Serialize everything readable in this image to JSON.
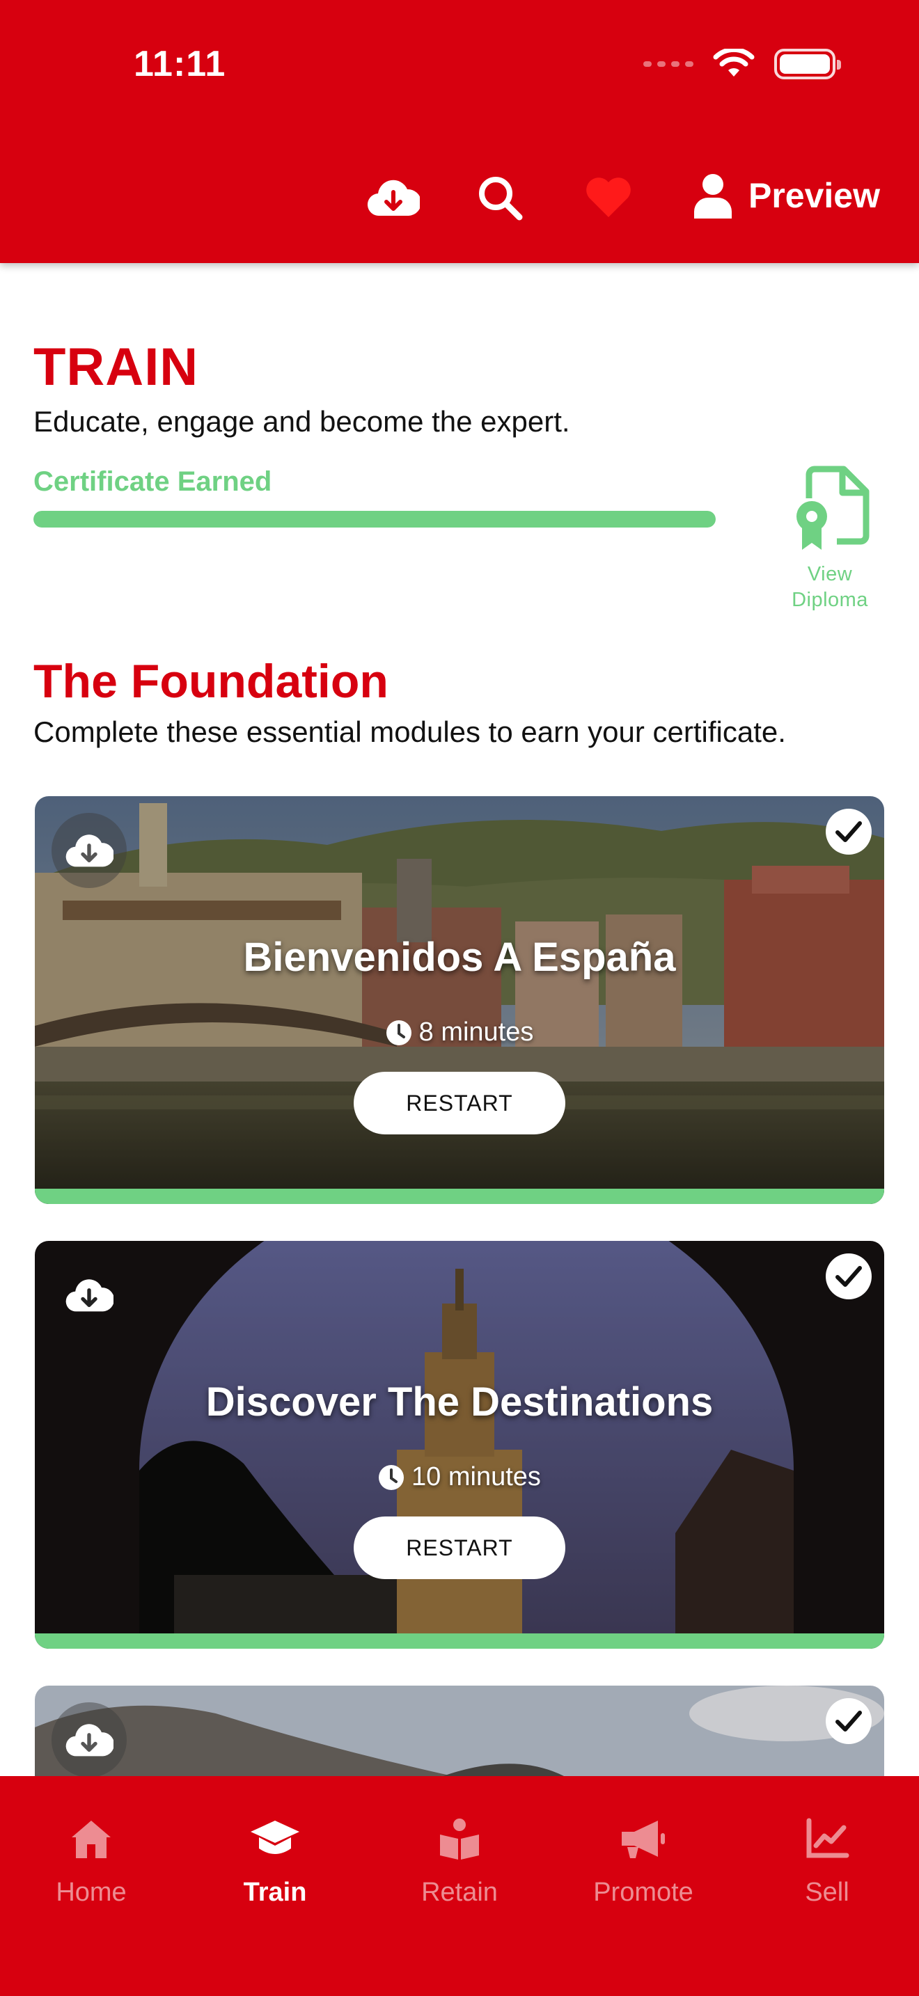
{
  "status_bar": {
    "time": "11:11"
  },
  "header": {
    "preview_label": "Preview",
    "colors": {
      "brand": "#d7000f",
      "favorite": "#ff1a1a"
    }
  },
  "train": {
    "title": "TRAIN",
    "subtitle": "Educate, engage and become the expert.",
    "certificate_label": "Certificate Earned",
    "progress": 1.0,
    "diploma_label_line1": "View",
    "diploma_label_line2": "Diploma",
    "accent_color": "#6fd183"
  },
  "foundation": {
    "title": "The Foundation",
    "subtitle": "Complete these essential modules to earn your certificate."
  },
  "modules": [
    {
      "title": "Bienvenidos A España",
      "duration": "8 minutes",
      "button": "RESTART",
      "completed": true,
      "progress": 1.0
    },
    {
      "title": "Discover The Destinations",
      "duration": "10 minutes",
      "button": "RESTART",
      "completed": true,
      "progress": 1.0
    },
    {
      "completed": true
    }
  ],
  "tabs": [
    {
      "label": "Home",
      "icon": "home-icon",
      "active": false
    },
    {
      "label": "Train",
      "icon": "graduation-cap-icon",
      "active": true
    },
    {
      "label": "Retain",
      "icon": "reader-icon",
      "active": false
    },
    {
      "label": "Promote",
      "icon": "megaphone-icon",
      "active": false
    },
    {
      "label": "Sell",
      "icon": "chart-line-icon",
      "active": false
    }
  ]
}
